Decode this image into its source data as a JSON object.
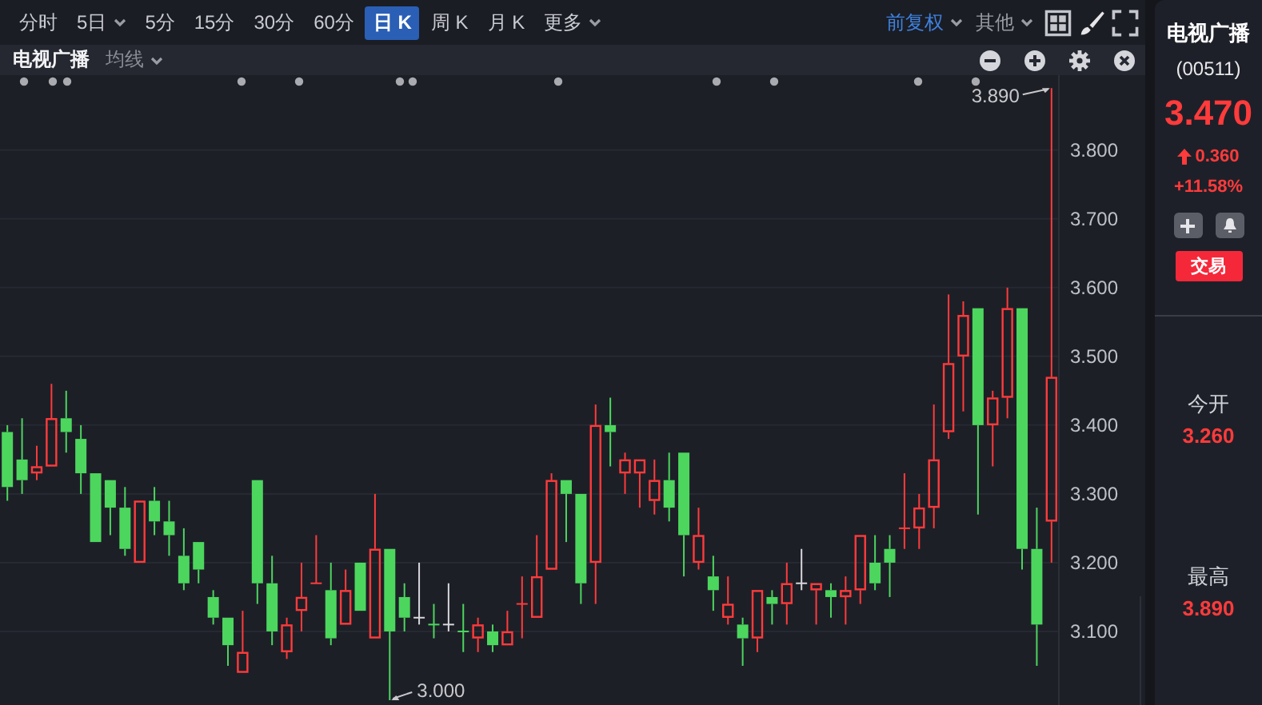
{
  "toolbar": {
    "periods": [
      {
        "label": "分时",
        "selected": false,
        "dropdown": false
      },
      {
        "label": "5日",
        "selected": false,
        "dropdown": true
      },
      {
        "label": "5分",
        "selected": false,
        "dropdown": false
      },
      {
        "label": "15分",
        "selected": false,
        "dropdown": false
      },
      {
        "label": "30分",
        "selected": false,
        "dropdown": false
      },
      {
        "label": "60分",
        "selected": false,
        "dropdown": false
      },
      {
        "label": "日 K",
        "selected": true,
        "dropdown": false
      },
      {
        "label": "周 K",
        "selected": false,
        "dropdown": false
      },
      {
        "label": "月 K",
        "selected": false,
        "dropdown": false
      },
      {
        "label": "更多",
        "selected": false,
        "dropdown": true
      }
    ],
    "adjust": "前复权",
    "other": "其他"
  },
  "chart_header": {
    "title": "电视广播",
    "indicator": "均线"
  },
  "chart": {
    "high_label": "3.890",
    "low_label": "3.000",
    "chart_data": {
      "type": "candlestick",
      "grid": true,
      "ylim": [
        2.993,
        3.909
      ],
      "yticks": [
        {
          "value": 3.1,
          "label": "3.100"
        },
        {
          "value": 3.2,
          "label": "3.200"
        },
        {
          "value": 3.3,
          "label": "3.300"
        },
        {
          "value": 3.4,
          "label": "3.400"
        },
        {
          "value": 3.5,
          "label": "3.500"
        },
        {
          "value": 3.6,
          "label": "3.600"
        },
        {
          "value": 3.7,
          "label": "3.700"
        },
        {
          "value": 3.8,
          "label": "3.800"
        }
      ],
      "ohlc": [
        [
          3.39,
          3.4,
          3.29,
          3.31
        ],
        [
          3.35,
          3.41,
          3.3,
          3.32
        ],
        [
          3.33,
          3.37,
          3.32,
          3.34
        ],
        [
          3.34,
          3.46,
          3.34,
          3.41
        ],
        [
          3.41,
          3.45,
          3.36,
          3.39
        ],
        [
          3.38,
          3.4,
          3.3,
          3.33
        ],
        [
          3.33,
          3.33,
          3.23,
          3.23
        ],
        [
          3.32,
          3.32,
          3.24,
          3.28
        ],
        [
          3.28,
          3.31,
          3.21,
          3.22
        ],
        [
          3.2,
          3.29,
          3.2,
          3.29
        ],
        [
          3.29,
          3.31,
          3.24,
          3.26
        ],
        [
          3.26,
          3.29,
          3.21,
          3.24
        ],
        [
          3.21,
          3.25,
          3.16,
          3.17
        ],
        [
          3.23,
          3.23,
          3.17,
          3.19
        ],
        [
          3.15,
          3.16,
          3.11,
          3.12
        ],
        [
          3.12,
          3.12,
          3.05,
          3.08
        ],
        [
          3.04,
          3.13,
          3.04,
          3.07
        ],
        [
          3.32,
          3.32,
          3.14,
          3.17
        ],
        [
          3.17,
          3.21,
          3.08,
          3.1
        ],
        [
          3.07,
          3.12,
          3.06,
          3.11
        ],
        [
          3.13,
          3.2,
          3.1,
          3.15
        ],
        [
          3.17,
          3.24,
          3.17,
          3.17
        ],
        [
          3.16,
          3.2,
          3.08,
          3.09
        ],
        [
          3.11,
          3.19,
          3.11,
          3.16
        ],
        [
          3.2,
          3.2,
          3.13,
          3.13
        ],
        [
          3.09,
          3.3,
          3.09,
          3.22
        ],
        [
          3.22,
          3.22,
          3.0,
          3.1
        ],
        [
          3.15,
          3.17,
          3.1,
          3.12
        ],
        [
          3.12,
          3.2,
          3.11,
          3.12
        ],
        [
          3.11,
          3.14,
          3.09,
          3.11
        ],
        [
          3.11,
          3.17,
          3.1,
          3.11
        ],
        [
          3.1,
          3.14,
          3.07,
          3.1
        ],
        [
          3.09,
          3.12,
          3.07,
          3.11
        ],
        [
          3.1,
          3.11,
          3.07,
          3.08
        ],
        [
          3.08,
          3.13,
          3.08,
          3.1
        ],
        [
          3.14,
          3.18,
          3.09,
          3.14
        ],
        [
          3.12,
          3.24,
          3.12,
          3.18
        ],
        [
          3.19,
          3.33,
          3.19,
          3.32
        ],
        [
          3.32,
          3.32,
          3.23,
          3.3
        ],
        [
          3.3,
          3.3,
          3.14,
          3.17
        ],
        [
          3.2,
          3.43,
          3.14,
          3.4
        ],
        [
          3.4,
          3.44,
          3.34,
          3.39
        ],
        [
          3.33,
          3.36,
          3.3,
          3.35
        ],
        [
          3.33,
          3.35,
          3.28,
          3.35
        ],
        [
          3.29,
          3.35,
          3.27,
          3.32
        ],
        [
          3.32,
          3.36,
          3.26,
          3.28
        ],
        [
          3.36,
          3.36,
          3.18,
          3.24
        ],
        [
          3.2,
          3.28,
          3.19,
          3.24
        ],
        [
          3.18,
          3.21,
          3.13,
          3.16
        ],
        [
          3.12,
          3.18,
          3.11,
          3.14
        ],
        [
          3.11,
          3.12,
          3.05,
          3.09
        ],
        [
          3.09,
          3.16,
          3.07,
          3.16
        ],
        [
          3.15,
          3.16,
          3.11,
          3.14
        ],
        [
          3.14,
          3.2,
          3.11,
          3.17
        ],
        [
          3.17,
          3.22,
          3.16,
          3.17
        ],
        [
          3.16,
          3.17,
          3.11,
          3.17
        ],
        [
          3.16,
          3.17,
          3.12,
          3.15
        ],
        [
          3.15,
          3.18,
          3.11,
          3.16
        ],
        [
          3.16,
          3.24,
          3.14,
          3.24
        ],
        [
          3.2,
          3.24,
          3.16,
          3.17
        ],
        [
          3.22,
          3.24,
          3.15,
          3.2
        ],
        [
          3.25,
          3.33,
          3.22,
          3.25
        ],
        [
          3.25,
          3.3,
          3.22,
          3.28
        ],
        [
          3.28,
          3.43,
          3.25,
          3.35
        ],
        [
          3.39,
          3.59,
          3.38,
          3.49
        ],
        [
          3.5,
          3.58,
          3.42,
          3.56
        ],
        [
          3.57,
          3.57,
          3.27,
          3.4
        ],
        [
          3.4,
          3.45,
          3.34,
          3.44
        ],
        [
          3.44,
          3.6,
          3.41,
          3.57
        ],
        [
          3.57,
          3.57,
          3.19,
          3.22
        ],
        [
          3.22,
          3.28,
          3.05,
          3.11
        ],
        [
          3.26,
          3.89,
          3.2,
          3.47
        ]
      ]
    }
  },
  "quote": {
    "name": "电视广播",
    "code": "(00511)",
    "price": "3.470",
    "change": "0.360",
    "change_pct": "+11.58%",
    "trade_button": "交易",
    "stats": [
      {
        "label": "今开",
        "value": "3.260"
      },
      {
        "label": "最高",
        "value": "3.890"
      }
    ]
  }
}
